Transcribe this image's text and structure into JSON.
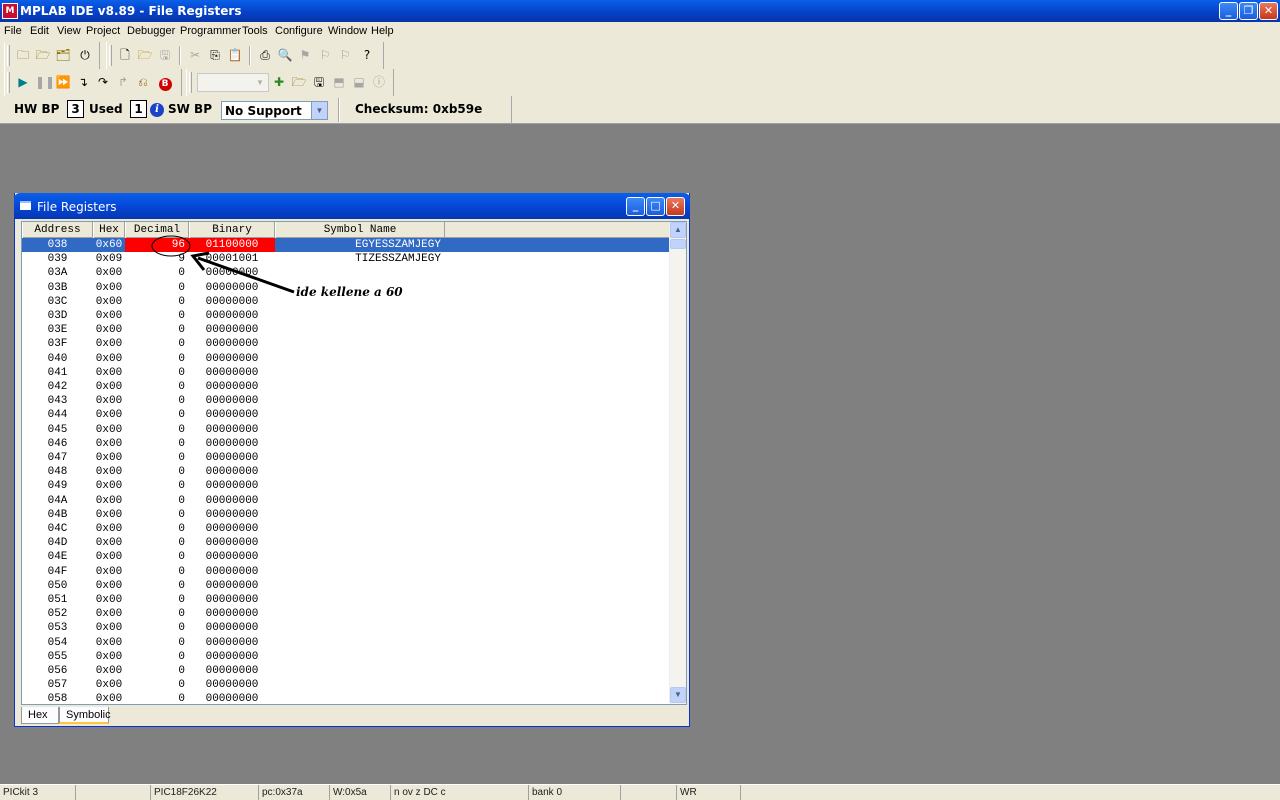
{
  "app": {
    "title": "MPLAB IDE v8.89 - File Registers",
    "icon_text": "M"
  },
  "menu": [
    "File",
    "Edit",
    "View",
    "Project",
    "Debugger",
    "Programmer",
    "Tools",
    "Configure",
    "Window",
    "Help"
  ],
  "breakpoints": {
    "hw_label": "HW BP",
    "hw_count": "3",
    "used_label": "Used",
    "sw_count": "1",
    "sw_label": "SW BP",
    "sw_select": "No Support",
    "checksum": "Checksum:  0xb59e"
  },
  "window": {
    "title": "File Registers",
    "columns": [
      "Address",
      "Hex",
      "Decimal",
      "Binary",
      "Symbol Name"
    ],
    "rows": [
      {
        "addr": "038",
        "hex": "0x60",
        "dec": "96",
        "bin": "01100000",
        "sym": "EGYESSZAMJEGY",
        "selected": true
      },
      {
        "addr": "039",
        "hex": "0x09",
        "dec": "9",
        "bin": "00001001",
        "sym": "TIZESSZAMJEGY"
      },
      {
        "addr": "03A",
        "hex": "0x00",
        "dec": "0",
        "bin": "00000000",
        "sym": ""
      },
      {
        "addr": "03B",
        "hex": "0x00",
        "dec": "0",
        "bin": "00000000",
        "sym": ""
      },
      {
        "addr": "03C",
        "hex": "0x00",
        "dec": "0",
        "bin": "00000000",
        "sym": ""
      },
      {
        "addr": "03D",
        "hex": "0x00",
        "dec": "0",
        "bin": "00000000",
        "sym": ""
      },
      {
        "addr": "03E",
        "hex": "0x00",
        "dec": "0",
        "bin": "00000000",
        "sym": ""
      },
      {
        "addr": "03F",
        "hex": "0x00",
        "dec": "0",
        "bin": "00000000",
        "sym": ""
      },
      {
        "addr": "040",
        "hex": "0x00",
        "dec": "0",
        "bin": "00000000",
        "sym": ""
      },
      {
        "addr": "041",
        "hex": "0x00",
        "dec": "0",
        "bin": "00000000",
        "sym": ""
      },
      {
        "addr": "042",
        "hex": "0x00",
        "dec": "0",
        "bin": "00000000",
        "sym": ""
      },
      {
        "addr": "043",
        "hex": "0x00",
        "dec": "0",
        "bin": "00000000",
        "sym": ""
      },
      {
        "addr": "044",
        "hex": "0x00",
        "dec": "0",
        "bin": "00000000",
        "sym": ""
      },
      {
        "addr": "045",
        "hex": "0x00",
        "dec": "0",
        "bin": "00000000",
        "sym": ""
      },
      {
        "addr": "046",
        "hex": "0x00",
        "dec": "0",
        "bin": "00000000",
        "sym": ""
      },
      {
        "addr": "047",
        "hex": "0x00",
        "dec": "0",
        "bin": "00000000",
        "sym": ""
      },
      {
        "addr": "048",
        "hex": "0x00",
        "dec": "0",
        "bin": "00000000",
        "sym": ""
      },
      {
        "addr": "049",
        "hex": "0x00",
        "dec": "0",
        "bin": "00000000",
        "sym": ""
      },
      {
        "addr": "04A",
        "hex": "0x00",
        "dec": "0",
        "bin": "00000000",
        "sym": ""
      },
      {
        "addr": "04B",
        "hex": "0x00",
        "dec": "0",
        "bin": "00000000",
        "sym": ""
      },
      {
        "addr": "04C",
        "hex": "0x00",
        "dec": "0",
        "bin": "00000000",
        "sym": ""
      },
      {
        "addr": "04D",
        "hex": "0x00",
        "dec": "0",
        "bin": "00000000",
        "sym": ""
      },
      {
        "addr": "04E",
        "hex": "0x00",
        "dec": "0",
        "bin": "00000000",
        "sym": ""
      },
      {
        "addr": "04F",
        "hex": "0x00",
        "dec": "0",
        "bin": "00000000",
        "sym": ""
      },
      {
        "addr": "050",
        "hex": "0x00",
        "dec": "0",
        "bin": "00000000",
        "sym": ""
      },
      {
        "addr": "051",
        "hex": "0x00",
        "dec": "0",
        "bin": "00000000",
        "sym": ""
      },
      {
        "addr": "052",
        "hex": "0x00",
        "dec": "0",
        "bin": "00000000",
        "sym": ""
      },
      {
        "addr": "053",
        "hex": "0x00",
        "dec": "0",
        "bin": "00000000",
        "sym": ""
      },
      {
        "addr": "054",
        "hex": "0x00",
        "dec": "0",
        "bin": "00000000",
        "sym": ""
      },
      {
        "addr": "055",
        "hex": "0x00",
        "dec": "0",
        "bin": "00000000",
        "sym": ""
      },
      {
        "addr": "056",
        "hex": "0x00",
        "dec": "0",
        "bin": "00000000",
        "sym": ""
      },
      {
        "addr": "057",
        "hex": "0x00",
        "dec": "0",
        "bin": "00000000",
        "sym": ""
      },
      {
        "addr": "058",
        "hex": "0x00",
        "dec": "0",
        "bin": "00000000",
        "sym": ""
      }
    ],
    "tabs": [
      "Hex",
      "Symbolic"
    ],
    "active_tab": "Symbolic"
  },
  "annotation": {
    "text": "ide kellene a 60"
  },
  "statusbar": [
    "PICkit 3",
    "PIC18F26K22",
    "pc:0x37a",
    "W:0x5a",
    "n ov z DC c",
    "bank 0",
    "WR"
  ],
  "colors": {
    "selection": "#316ac5",
    "changed": "#ff0000",
    "desktop": "#808080",
    "chrome": "#ece9d8"
  }
}
